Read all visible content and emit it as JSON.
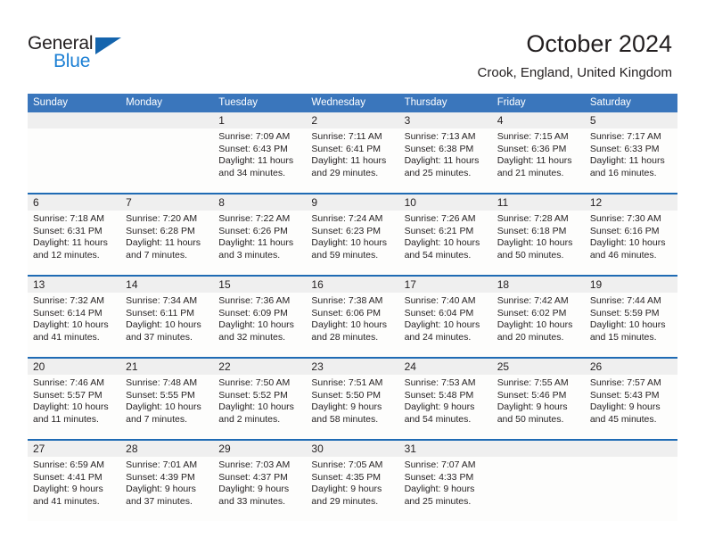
{
  "brand": {
    "name_part1": "General",
    "name_part2": "Blue",
    "color_dark": "#231f20",
    "color_blue": "#1b7fd4",
    "triangle_color": "#1464ad"
  },
  "header": {
    "title": "October 2024",
    "subtitle": "Crook, England, United Kingdom",
    "header_bg": "#3a76bc",
    "header_text": "#ffffff"
  },
  "weekdays": [
    "Sunday",
    "Monday",
    "Tuesday",
    "Wednesday",
    "Thursday",
    "Friday",
    "Saturday"
  ],
  "weeks": [
    [
      {
        "day": "",
        "sunrise": "",
        "sunset": "",
        "daylight_line1": "",
        "daylight_line2": ""
      },
      {
        "day": "",
        "sunrise": "",
        "sunset": "",
        "daylight_line1": "",
        "daylight_line2": ""
      },
      {
        "day": "1",
        "sunrise": "Sunrise: 7:09 AM",
        "sunset": "Sunset: 6:43 PM",
        "daylight_line1": "Daylight: 11 hours",
        "daylight_line2": "and 34 minutes."
      },
      {
        "day": "2",
        "sunrise": "Sunrise: 7:11 AM",
        "sunset": "Sunset: 6:41 PM",
        "daylight_line1": "Daylight: 11 hours",
        "daylight_line2": "and 29 minutes."
      },
      {
        "day": "3",
        "sunrise": "Sunrise: 7:13 AM",
        "sunset": "Sunset: 6:38 PM",
        "daylight_line1": "Daylight: 11 hours",
        "daylight_line2": "and 25 minutes."
      },
      {
        "day": "4",
        "sunrise": "Sunrise: 7:15 AM",
        "sunset": "Sunset: 6:36 PM",
        "daylight_line1": "Daylight: 11 hours",
        "daylight_line2": "and 21 minutes."
      },
      {
        "day": "5",
        "sunrise": "Sunrise: 7:17 AM",
        "sunset": "Sunset: 6:33 PM",
        "daylight_line1": "Daylight: 11 hours",
        "daylight_line2": "and 16 minutes."
      }
    ],
    [
      {
        "day": "6",
        "sunrise": "Sunrise: 7:18 AM",
        "sunset": "Sunset: 6:31 PM",
        "daylight_line1": "Daylight: 11 hours",
        "daylight_line2": "and 12 minutes."
      },
      {
        "day": "7",
        "sunrise": "Sunrise: 7:20 AM",
        "sunset": "Sunset: 6:28 PM",
        "daylight_line1": "Daylight: 11 hours",
        "daylight_line2": "and 7 minutes."
      },
      {
        "day": "8",
        "sunrise": "Sunrise: 7:22 AM",
        "sunset": "Sunset: 6:26 PM",
        "daylight_line1": "Daylight: 11 hours",
        "daylight_line2": "and 3 minutes."
      },
      {
        "day": "9",
        "sunrise": "Sunrise: 7:24 AM",
        "sunset": "Sunset: 6:23 PM",
        "daylight_line1": "Daylight: 10 hours",
        "daylight_line2": "and 59 minutes."
      },
      {
        "day": "10",
        "sunrise": "Sunrise: 7:26 AM",
        "sunset": "Sunset: 6:21 PM",
        "daylight_line1": "Daylight: 10 hours",
        "daylight_line2": "and 54 minutes."
      },
      {
        "day": "11",
        "sunrise": "Sunrise: 7:28 AM",
        "sunset": "Sunset: 6:18 PM",
        "daylight_line1": "Daylight: 10 hours",
        "daylight_line2": "and 50 minutes."
      },
      {
        "day": "12",
        "sunrise": "Sunrise: 7:30 AM",
        "sunset": "Sunset: 6:16 PM",
        "daylight_line1": "Daylight: 10 hours",
        "daylight_line2": "and 46 minutes."
      }
    ],
    [
      {
        "day": "13",
        "sunrise": "Sunrise: 7:32 AM",
        "sunset": "Sunset: 6:14 PM",
        "daylight_line1": "Daylight: 10 hours",
        "daylight_line2": "and 41 minutes."
      },
      {
        "day": "14",
        "sunrise": "Sunrise: 7:34 AM",
        "sunset": "Sunset: 6:11 PM",
        "daylight_line1": "Daylight: 10 hours",
        "daylight_line2": "and 37 minutes."
      },
      {
        "day": "15",
        "sunrise": "Sunrise: 7:36 AM",
        "sunset": "Sunset: 6:09 PM",
        "daylight_line1": "Daylight: 10 hours",
        "daylight_line2": "and 32 minutes."
      },
      {
        "day": "16",
        "sunrise": "Sunrise: 7:38 AM",
        "sunset": "Sunset: 6:06 PM",
        "daylight_line1": "Daylight: 10 hours",
        "daylight_line2": "and 28 minutes."
      },
      {
        "day": "17",
        "sunrise": "Sunrise: 7:40 AM",
        "sunset": "Sunset: 6:04 PM",
        "daylight_line1": "Daylight: 10 hours",
        "daylight_line2": "and 24 minutes."
      },
      {
        "day": "18",
        "sunrise": "Sunrise: 7:42 AM",
        "sunset": "Sunset: 6:02 PM",
        "daylight_line1": "Daylight: 10 hours",
        "daylight_line2": "and 20 minutes."
      },
      {
        "day": "19",
        "sunrise": "Sunrise: 7:44 AM",
        "sunset": "Sunset: 5:59 PM",
        "daylight_line1": "Daylight: 10 hours",
        "daylight_line2": "and 15 minutes."
      }
    ],
    [
      {
        "day": "20",
        "sunrise": "Sunrise: 7:46 AM",
        "sunset": "Sunset: 5:57 PM",
        "daylight_line1": "Daylight: 10 hours",
        "daylight_line2": "and 11 minutes."
      },
      {
        "day": "21",
        "sunrise": "Sunrise: 7:48 AM",
        "sunset": "Sunset: 5:55 PM",
        "daylight_line1": "Daylight: 10 hours",
        "daylight_line2": "and 7 minutes."
      },
      {
        "day": "22",
        "sunrise": "Sunrise: 7:50 AM",
        "sunset": "Sunset: 5:52 PM",
        "daylight_line1": "Daylight: 10 hours",
        "daylight_line2": "and 2 minutes."
      },
      {
        "day": "23",
        "sunrise": "Sunrise: 7:51 AM",
        "sunset": "Sunset: 5:50 PM",
        "daylight_line1": "Daylight: 9 hours",
        "daylight_line2": "and 58 minutes."
      },
      {
        "day": "24",
        "sunrise": "Sunrise: 7:53 AM",
        "sunset": "Sunset: 5:48 PM",
        "daylight_line1": "Daylight: 9 hours",
        "daylight_line2": "and 54 minutes."
      },
      {
        "day": "25",
        "sunrise": "Sunrise: 7:55 AM",
        "sunset": "Sunset: 5:46 PM",
        "daylight_line1": "Daylight: 9 hours",
        "daylight_line2": "and 50 minutes."
      },
      {
        "day": "26",
        "sunrise": "Sunrise: 7:57 AM",
        "sunset": "Sunset: 5:43 PM",
        "daylight_line1": "Daylight: 9 hours",
        "daylight_line2": "and 45 minutes."
      }
    ],
    [
      {
        "day": "27",
        "sunrise": "Sunrise: 6:59 AM",
        "sunset": "Sunset: 4:41 PM",
        "daylight_line1": "Daylight: 9 hours",
        "daylight_line2": "and 41 minutes."
      },
      {
        "day": "28",
        "sunrise": "Sunrise: 7:01 AM",
        "sunset": "Sunset: 4:39 PM",
        "daylight_line1": "Daylight: 9 hours",
        "daylight_line2": "and 37 minutes."
      },
      {
        "day": "29",
        "sunrise": "Sunrise: 7:03 AM",
        "sunset": "Sunset: 4:37 PM",
        "daylight_line1": "Daylight: 9 hours",
        "daylight_line2": "and 33 minutes."
      },
      {
        "day": "30",
        "sunrise": "Sunrise: 7:05 AM",
        "sunset": "Sunset: 4:35 PM",
        "daylight_line1": "Daylight: 9 hours",
        "daylight_line2": "and 29 minutes."
      },
      {
        "day": "31",
        "sunrise": "Sunrise: 7:07 AM",
        "sunset": "Sunset: 4:33 PM",
        "daylight_line1": "Daylight: 9 hours",
        "daylight_line2": "and 25 minutes."
      },
      {
        "day": "",
        "sunrise": "",
        "sunset": "",
        "daylight_line1": "",
        "daylight_line2": ""
      },
      {
        "day": "",
        "sunrise": "",
        "sunset": "",
        "daylight_line1": "",
        "daylight_line2": ""
      }
    ]
  ]
}
